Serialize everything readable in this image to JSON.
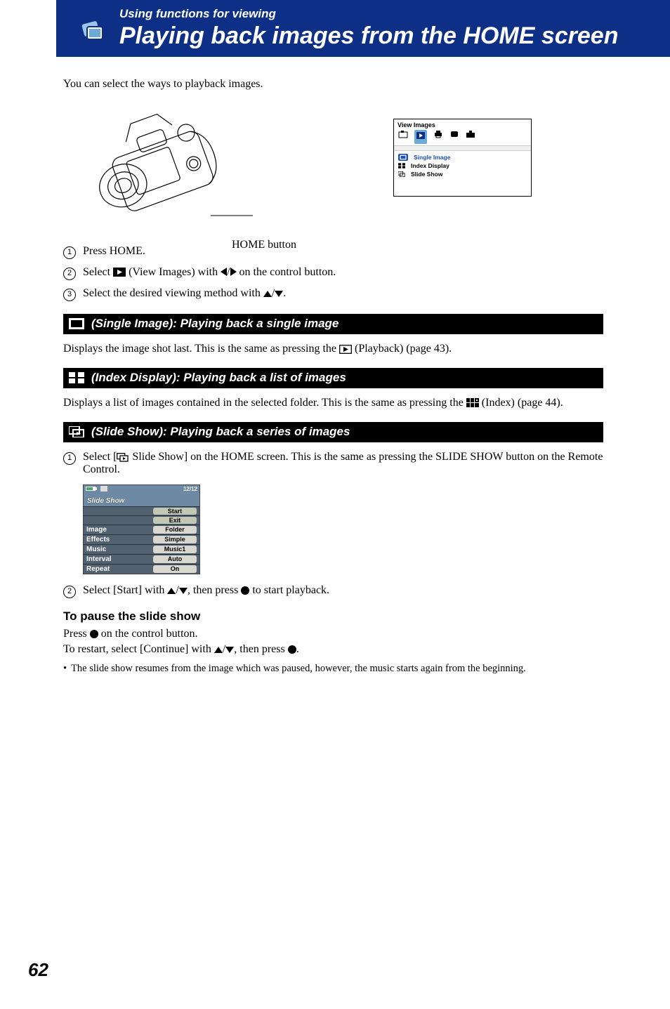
{
  "header": {
    "section": "Using functions for viewing",
    "title": "Playing back images from the HOME screen"
  },
  "intro": "You can select the ways to playback images.",
  "home_button_label": "HOME button",
  "menu_screen": {
    "title": "View Images",
    "items": [
      {
        "label": "Single Image",
        "selected": true
      },
      {
        "label": "Index Display",
        "selected": false
      },
      {
        "label": "Slide Show",
        "selected": false
      }
    ]
  },
  "steps_main": [
    "Press HOME.",
    "Select (View Images) with / on the control button.",
    "Select the desired viewing method with /."
  ],
  "steps_main_parts": {
    "s1": "Press HOME.",
    "s2a": "Select ",
    "s2b": " (View Images) with ",
    "s2c": " on the control button.",
    "s3a": "Select the desired viewing method with ",
    "s3b": "."
  },
  "section_single": {
    "heading": " (Single Image): Playing back a single image",
    "body_a": "Displays the image shot last. This is the same as pressing the ",
    "body_b": " (Playback) (page 43)."
  },
  "section_index": {
    "heading": " (Index Display): Playing back a list of images",
    "body_a": "Displays a list of images contained in the selected folder. This is the same as pressing the ",
    "body_b": " (Index) (page 44)."
  },
  "section_slide": {
    "heading": " (Slide Show): Playing back a series of images",
    "step1_a": "Select [",
    "step1_b": " Slide Show] on the HOME screen. This is the same as pressing the SLIDE SHOW button on the Remote Control.",
    "step2_a": "Select [Start] with ",
    "step2_b": ", then press ",
    "step2_c": " to start playback."
  },
  "slide_menu": {
    "title": "Slide Show",
    "counter": "12/12",
    "rows": [
      {
        "label": "",
        "value": "Start",
        "btn": true
      },
      {
        "label": "",
        "value": "Exit",
        "btn": true
      },
      {
        "label": "Image",
        "value": "Folder"
      },
      {
        "label": "Effects",
        "value": "Simple"
      },
      {
        "label": "Music",
        "value": "Music1"
      },
      {
        "label": "Interval",
        "value": "Auto"
      },
      {
        "label": "Repeat",
        "value": "On"
      }
    ]
  },
  "pause": {
    "heading": "To pause the slide show",
    "p1_a": "Press ",
    "p1_b": " on the control button.",
    "p2_a": "To restart, select [Continue] with ",
    "p2_b": ", then press ",
    "p2_c": ".",
    "note": "The slide show resumes from the image which was paused, however, the music starts again from the beginning."
  },
  "page_number": "62"
}
